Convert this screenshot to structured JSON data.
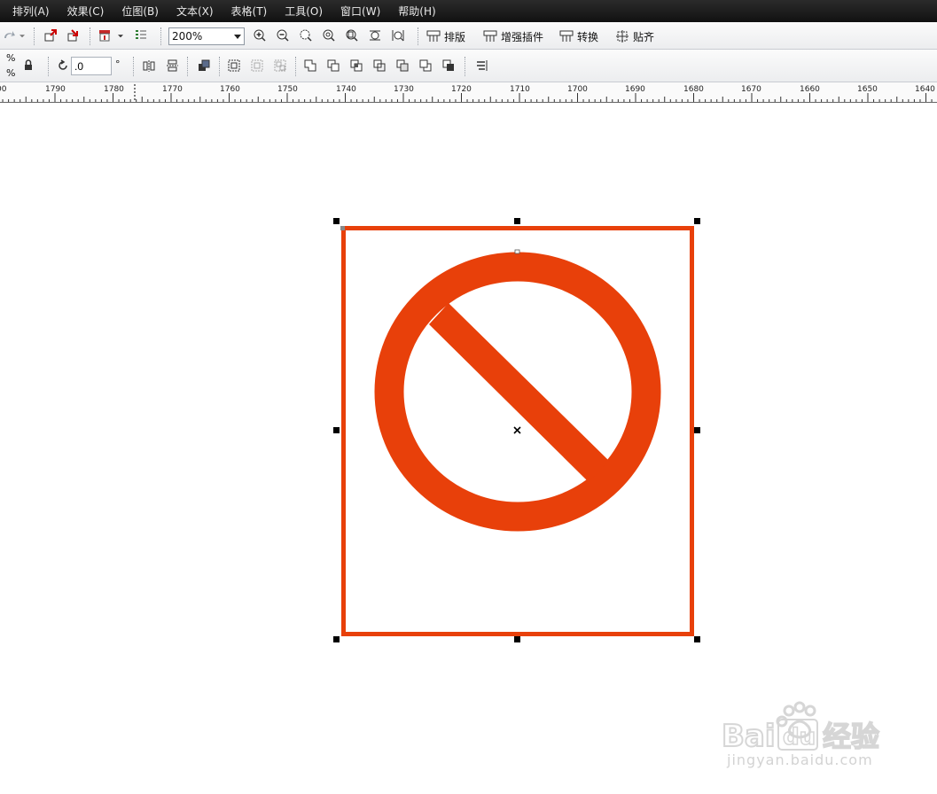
{
  "menu": [
    {
      "label": "排列(A)"
    },
    {
      "label": "效果(C)"
    },
    {
      "label": "位图(B)"
    },
    {
      "label": "文本(X)"
    },
    {
      "label": "表格(T)"
    },
    {
      "label": "工具(O)"
    },
    {
      "label": "窗口(W)"
    },
    {
      "label": "帮助(H)"
    }
  ],
  "toolbar": {
    "zoom_value": "200%",
    "layout_label": "排版",
    "plugin_label": "增强插件",
    "convert_label": "转换",
    "snap_label": "贴齐"
  },
  "property_bar": {
    "angle_value": ".0",
    "degree_symbol": "°",
    "percent_symbol": "%"
  },
  "ruler": {
    "labels": [
      "00",
      "1790",
      "1780",
      "1770",
      "1760",
      "1750",
      "1740",
      "1730",
      "1720",
      "1710",
      "1700",
      "1690",
      "1680",
      "1670",
      "1660",
      "1650",
      "1640"
    ]
  },
  "colors": {
    "accent": "#e8400a",
    "menubar": "#1c1c1c",
    "handle": "#000000"
  },
  "watermark": {
    "brand": "Baidu经验",
    "url": "jingyan.baidu.com"
  }
}
